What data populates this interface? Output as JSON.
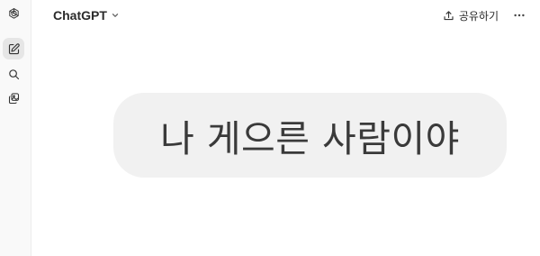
{
  "header": {
    "model_name": "ChatGPT",
    "share_label": "공유하기"
  },
  "sidebar": {
    "items": [
      {
        "name": "new-chat",
        "icon": "edit-icon",
        "active": true
      },
      {
        "name": "search",
        "icon": "search-icon",
        "active": false
      },
      {
        "name": "library",
        "icon": "images-icon",
        "active": false
      }
    ]
  },
  "conversation": {
    "messages": [
      {
        "role": "user",
        "text": "나 게으른 사람이야"
      }
    ]
  },
  "icons": {
    "logo": "openai-logo-icon",
    "model_dropdown": "chevron-down-icon",
    "share": "upload-icon",
    "more": "more-horizontal-icon"
  }
}
